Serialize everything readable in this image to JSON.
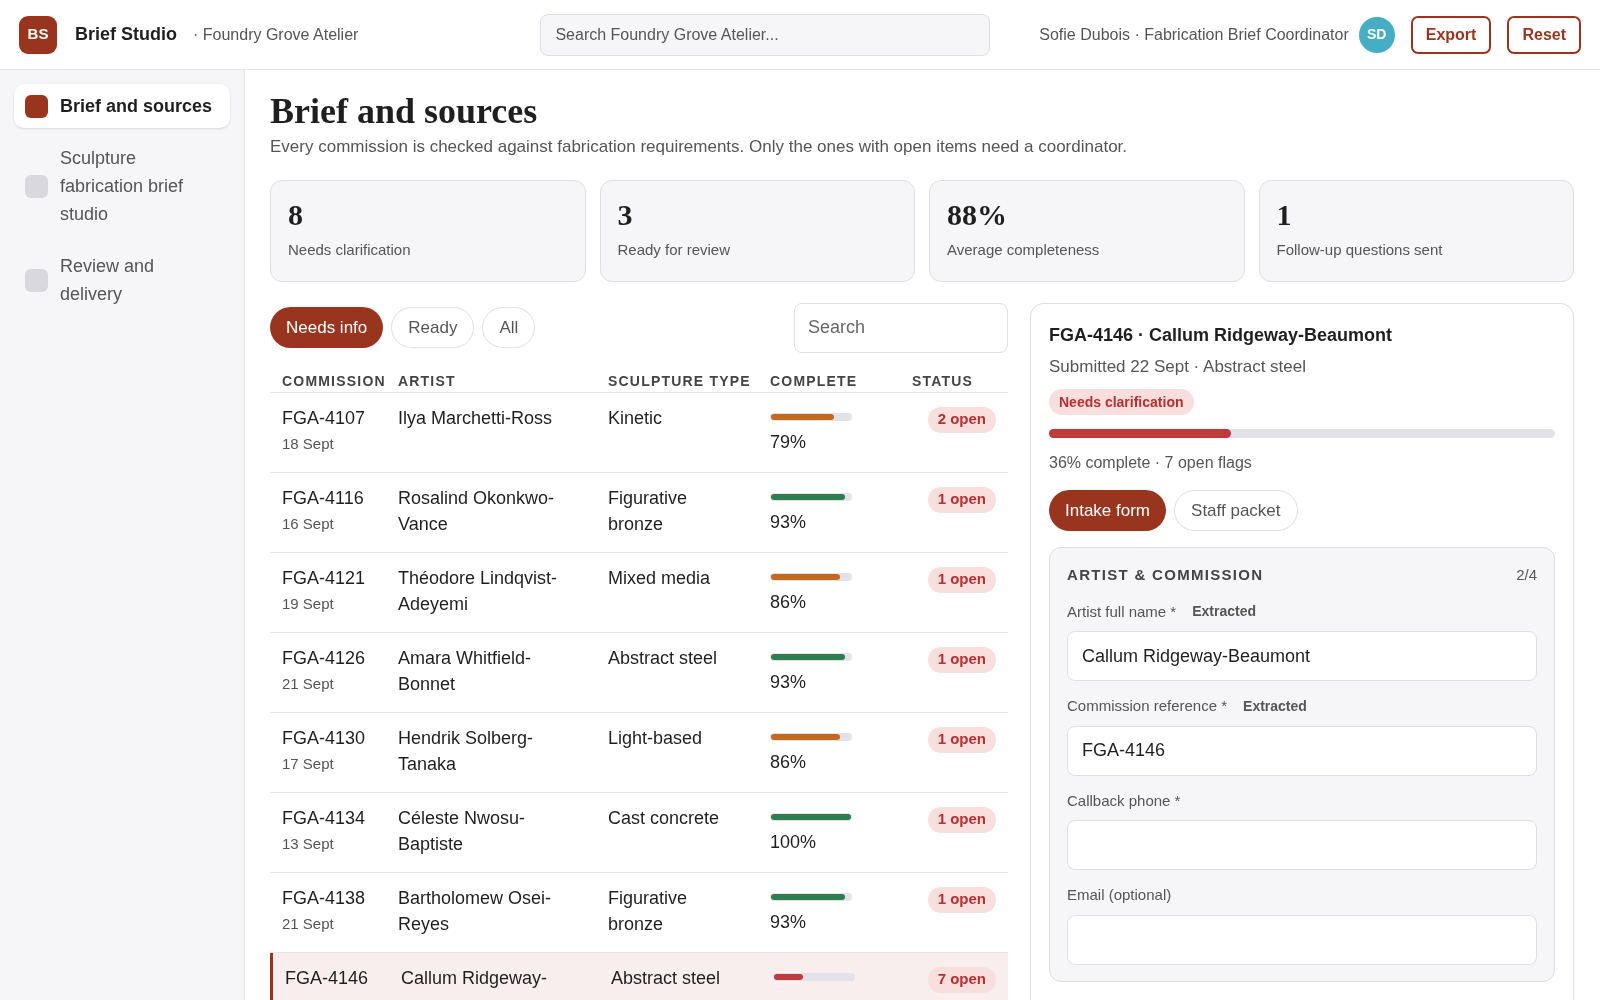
{
  "header": {
    "logo": "BS",
    "app_name": "Brief Studio",
    "workspace": "· Foundry Grove Atelier",
    "search": {
      "placeholder": "Search Foundry Grove Atelier..."
    },
    "user": "Sofie Dubois · Fabrication Brief Coordinator",
    "avatar": "SD",
    "buttons": [
      "Export",
      "Reset"
    ]
  },
  "sidebar": {
    "items": [
      {
        "label": "Brief and sources",
        "selected": true
      },
      {
        "label": "Sculpture fabrication brief studio",
        "selected": false
      },
      {
        "label": "Review and delivery",
        "selected": false
      }
    ]
  },
  "page": {
    "title": "Brief and sources",
    "subtitle": "Every commission is checked against fabrication requirements. Only the ones with open items need a coordinator."
  },
  "stats": [
    {
      "value": "8",
      "label": "Needs clarification"
    },
    {
      "value": "3",
      "label": "Ready for review"
    },
    {
      "value": "88%",
      "label": "Average completeness"
    },
    {
      "value": "1",
      "label": "Follow-up questions sent"
    }
  ],
  "filters": [
    {
      "label": "Needs info",
      "selected": true
    },
    {
      "label": "Ready",
      "selected": false
    },
    {
      "label": "All",
      "selected": false
    }
  ],
  "table_search": {
    "placeholder": "Search"
  },
  "table": {
    "columns": [
      "COMMISSION",
      "ARTIST",
      "SCULPTURE TYPE",
      "COMPLETE",
      "STATUS"
    ],
    "rows": [
      {
        "commission": "FGA-4107",
        "date": "18 Sept",
        "artist": "Ilya Marchetti-Ross",
        "type": "Kinetic",
        "level": 0.79,
        "percent": "79%",
        "status": "2 open",
        "selected": false
      },
      {
        "commission": "FGA-4116",
        "date": "16 Sept",
        "artist": "Rosalind Okonkwo-Vance",
        "type": "Figurative bronze",
        "level": 0.93,
        "percent": "93%",
        "status": "1 open",
        "selected": false
      },
      {
        "commission": "FGA-4121",
        "date": "19 Sept",
        "artist": "Théodore Lindqvist-Adeyemi",
        "type": "Mixed media",
        "level": 0.86,
        "percent": "86%",
        "status": "1 open",
        "selected": false
      },
      {
        "commission": "FGA-4126",
        "date": "21 Sept",
        "artist": "Amara Whitfield-Bonnet",
        "type": "Abstract steel",
        "level": 0.93,
        "percent": "93%",
        "status": "1 open",
        "selected": false
      },
      {
        "commission": "FGA-4130",
        "date": "17 Sept",
        "artist": "Hendrik Solberg-Tanaka",
        "type": "Light-based",
        "level": 0.86,
        "percent": "86%",
        "status": "1 open",
        "selected": false
      },
      {
        "commission": "FGA-4134",
        "date": "13 Sept",
        "artist": "Céleste Nwosu-Baptiste",
        "type": "Cast concrete",
        "level": 1,
        "percent": "100%",
        "status": "1 open",
        "selected": false
      },
      {
        "commission": "FGA-4138",
        "date": "21 Sept",
        "artist": "Bartholomew Osei-Reyes",
        "type": "Figurative bronze",
        "level": 0.93,
        "percent": "93%",
        "status": "1 open",
        "selected": false
      },
      {
        "commission": "FGA-4146",
        "artist": "Callum Ridgeway-",
        "type": "Abstract steel",
        "level": 0.36,
        "status": "7 open",
        "selected": true
      }
    ]
  },
  "detail": {
    "title": "FGA-4146 · Callum Ridgeway-Beaumont",
    "subtitle": "Submitted 22 Sept · Abstract steel",
    "badge": "Needs clarification",
    "level": 0.36,
    "summary": "36% complete · 7 open flags",
    "tabs": [
      {
        "label": "Intake form",
        "selected": true
      },
      {
        "label": "Staff packet",
        "selected": false
      }
    ],
    "section": {
      "title": "ARTIST & COMMISSION",
      "count": "2/4",
      "fields": [
        {
          "label": "Artist full name *",
          "tag": "Extracted",
          "value": "Callum Ridgeway-Beaumont"
        },
        {
          "label": "Commission reference *",
          "tag": "Extracted",
          "value": "FGA-4146"
        },
        {
          "label": "Callback phone *"
        },
        {
          "label": "Email (optional)"
        }
      ]
    }
  }
}
